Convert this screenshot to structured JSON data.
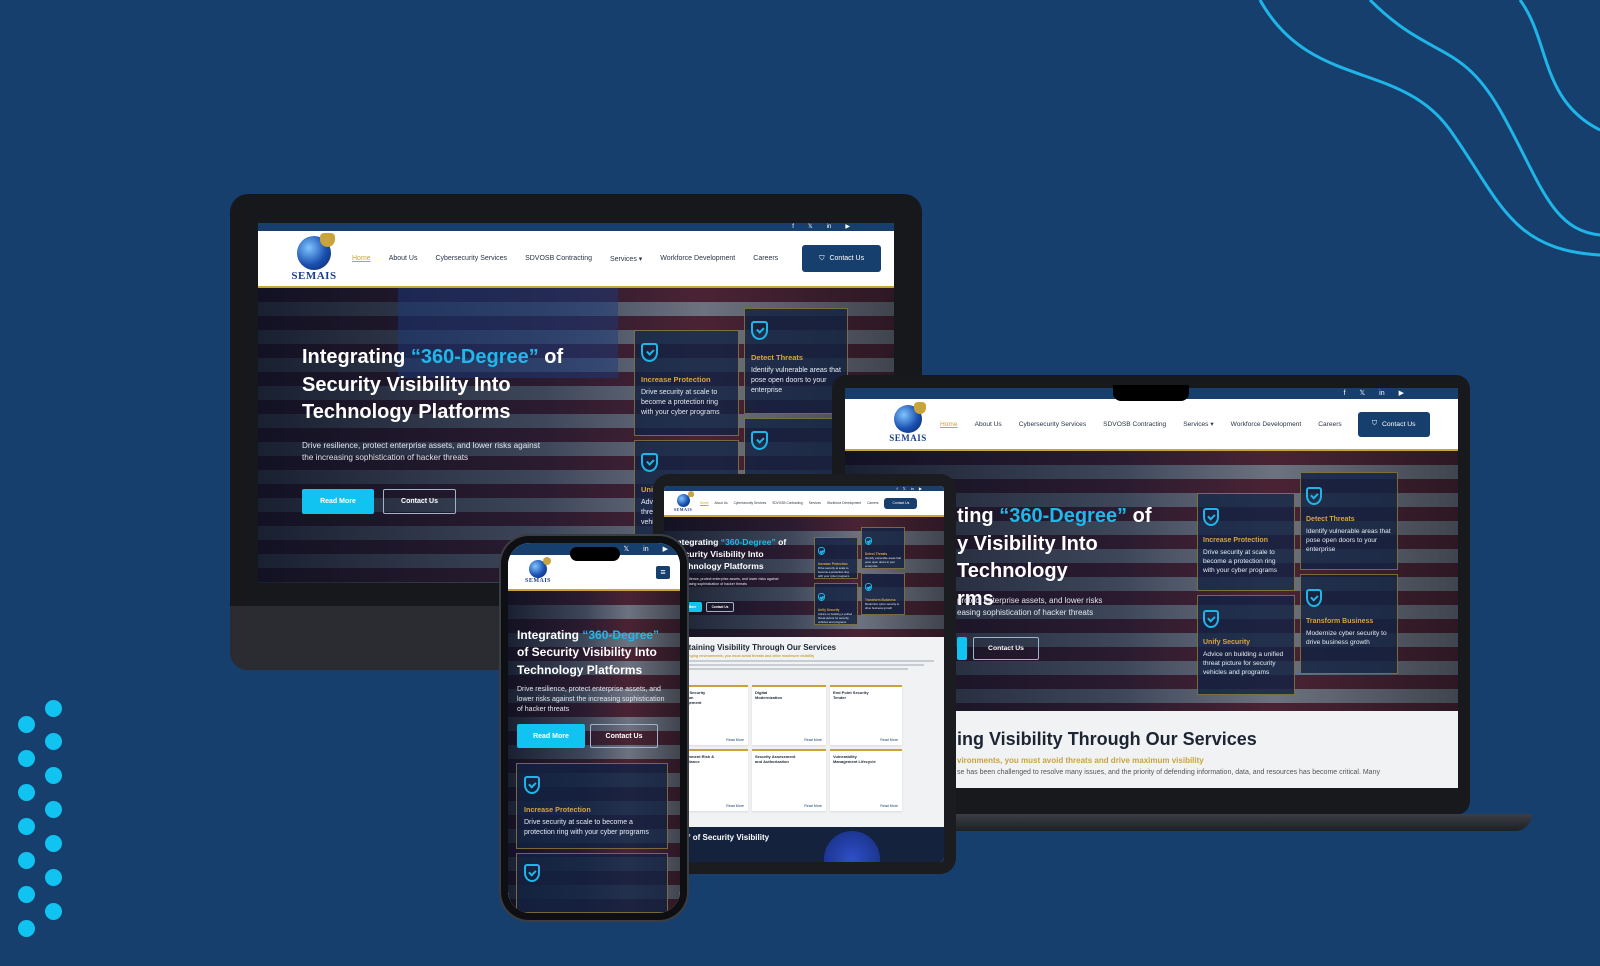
{
  "brand": {
    "logo_text": "SEMAIS"
  },
  "social": {
    "facebook": "f",
    "twitter": "𝕏",
    "linkedin": "in",
    "youtube": "▶"
  },
  "nav": {
    "home": "Home",
    "about": "About Us",
    "cyber": "Cybersecurity Services",
    "sdvosb": "SDVOSB Contracting",
    "services": "Services",
    "workforce": "Workforce Development",
    "careers": "Careers",
    "contact": "Contact Us"
  },
  "hero": {
    "title_pre": "Integrating ",
    "title_highlight": "“360-Degree”",
    "title_post": " of Security Visibility Into Technology Platforms",
    "laptop_title_pre": "ting ",
    "laptop_title_post": " of",
    "laptop_line2": "y Visibility Into Technology",
    "laptop_line3": "rms",
    "desc": "Drive resilience, protect enterprise assets, and lower risks against the increasing sophistication of hacker threats",
    "laptop_desc1": "protect enterprise assets, and lower risks",
    "laptop_desc2": "easing sophistication of hacker threats",
    "read_more": "Read More",
    "contact": "Contact Us"
  },
  "cards": {
    "increase_title": "Increase Protection",
    "increase_desc": "Drive security at scale to become a protection ring with your cyber programs",
    "detect_title": "Detect Threats",
    "detect_desc": "Identify vulnerable areas that pose open doors to your enterprise",
    "unify_title": "Unify Security",
    "unify_desc": "Advice on building a unified threat picture for security vehicles and programs",
    "unify_partial": "Uni",
    "unify_partial_desc": "Adv thre vehi",
    "transform_title": "Transform Business",
    "transform_desc": "Modernize cyber security to drive business growth"
  },
  "services": {
    "heading": "Sustaining Visibility Through Our Services",
    "laptop_heading": "ing Visibility Through Our Services",
    "subheading": "In challenging environments, you must avoid threats and drive maximum visibility",
    "laptop_sub": "vironments, you must avoid threats and drive maximum visibility",
    "laptop_body": "se has been challenged to resolve many issues, and the priority of defending information, data, and resources has become critical. Many",
    "card1": "Cyber Security Program Management",
    "card2": "Digital Modernization",
    "card3": "End Point Security Tender",
    "card4": "Government Risk & Compliance",
    "card5": "Security Assessment and Authorization",
    "card6": "Vulnerability Management Lifecycle",
    "read_more": "Read More",
    "footer_partial": "360° of Security Visibility"
  },
  "colors": {
    "bg": "#173f6e",
    "accent": "#11c3f0",
    "gold": "#c9a43a"
  }
}
